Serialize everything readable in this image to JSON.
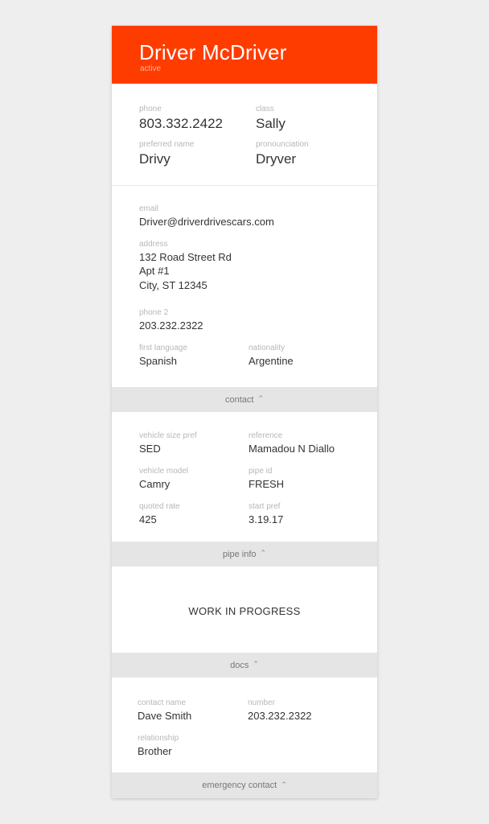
{
  "header": {
    "name": "Driver McDriver",
    "status": "active"
  },
  "summary": {
    "phone": {
      "label": "phone",
      "value": "803.332.2422"
    },
    "class": {
      "label": "class",
      "value": "Sally"
    },
    "preferred_name": {
      "label": "preferred name",
      "value": "Drivy"
    },
    "pronounciation": {
      "label": "pronounciation",
      "value": "Dryver"
    }
  },
  "contact": {
    "email": {
      "label": "email",
      "value": "Driver@driverdrivescars.com"
    },
    "address": {
      "label": "address",
      "line1": "132 Road Street Rd",
      "line2": "Apt #1",
      "line3": "City, ST  12345"
    },
    "phone2": {
      "label": "phone 2",
      "value": "203.232.2322"
    },
    "first_language": {
      "label": "first language",
      "value": "Spanish"
    },
    "nationality": {
      "label": "nationality",
      "value": "Argentine"
    },
    "section_label": "contact"
  },
  "pipe": {
    "vehicle_size_pref": {
      "label": "vehicle size pref",
      "value": "SED"
    },
    "reference": {
      "label": "reference",
      "value": "Mamadou N Diallo"
    },
    "vehicle_model": {
      "label": "vehicle model",
      "value": "Camry"
    },
    "pipe_id": {
      "label": "pipe id",
      "value": "FRESH"
    },
    "quoted_rate": {
      "label": "quoted rate",
      "value": "425"
    },
    "start_pref": {
      "label": "start pref",
      "value": "3.19.17"
    },
    "section_label": "pipe info"
  },
  "docs": {
    "content": "WORK IN PROGRESS",
    "section_label": "docs"
  },
  "emergency": {
    "contact_name": {
      "label": "contact name",
      "value": "Dave Smith"
    },
    "number": {
      "label": "number",
      "value": "203.232.2322"
    },
    "relationship": {
      "label": "relationship",
      "value": "Brother"
    },
    "section_label": "emergency contact"
  },
  "icons": {
    "collapse": "chevron-up-icon"
  },
  "colors": {
    "accent": "#ff3c00",
    "section_bar": "#e5e5e5",
    "background": "#eeeeee"
  }
}
